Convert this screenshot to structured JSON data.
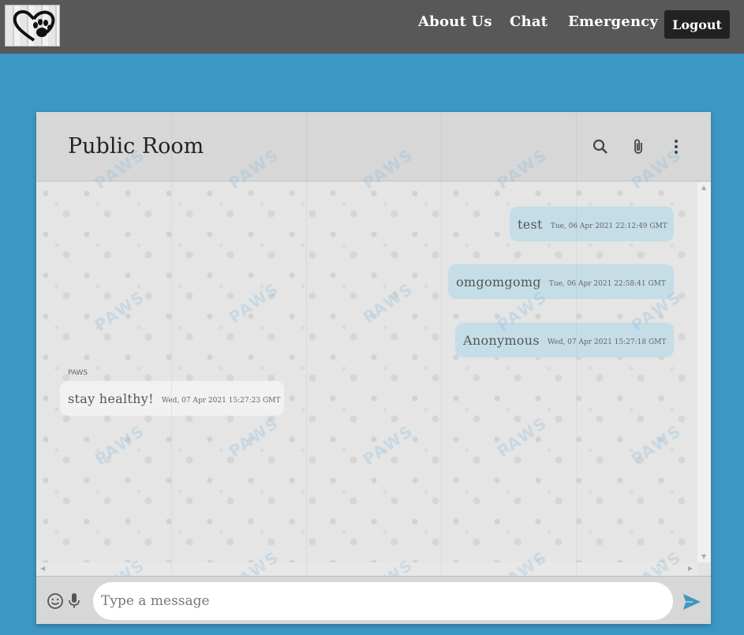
{
  "nav": {
    "about_label": "About Us",
    "chat_label": "Chat",
    "emergency_label": "Emergency",
    "logout_label": "Logout"
  },
  "chat": {
    "title": "Public Room",
    "messages": [
      {
        "text": "test",
        "time": "Tue, 06 Apr 2021 22:12:49 GMT",
        "direction": "outgoing"
      },
      {
        "text": "omgomgomg",
        "time": "Tue, 06 Apr 2021 22:58:41 GMT",
        "direction": "outgoing"
      },
      {
        "text": "Anonymous",
        "time": "Wed, 07 Apr 2021 15:27:18 GMT",
        "direction": "outgoing"
      },
      {
        "sender": "PAWS",
        "text": "stay healthy!",
        "time": "Wed, 07 Apr 2021 15:27:23 GMT",
        "direction": "incoming"
      }
    ],
    "watermark": "PAWS",
    "input_placeholder": "Type a message"
  },
  "icons": {
    "logo": "heart-paw-logo",
    "search": "search-icon",
    "attach": "paperclip-icon",
    "menu": "more-vert-icon",
    "emoji": "emoji-icon",
    "mic": "microphone-icon",
    "send": "send-icon"
  },
  "colors": {
    "background": "#3d97c4",
    "navbar": "#585858",
    "outgoing_bubble": "#c5dde6",
    "incoming_bubble": "#f1f1f1",
    "send_icon": "#3d97c4"
  }
}
